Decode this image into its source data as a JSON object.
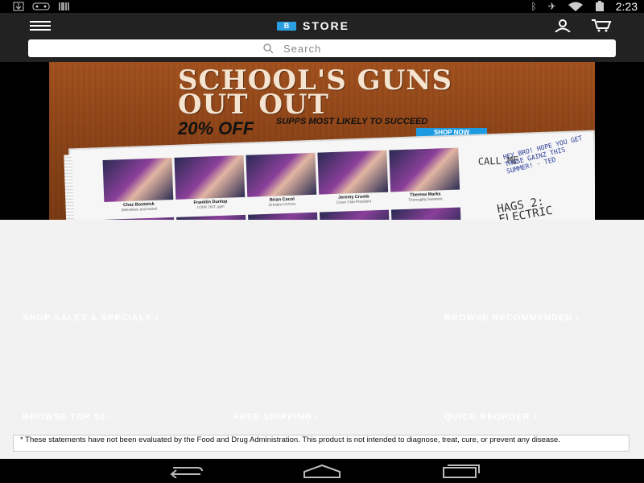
{
  "status_bar": {
    "left_icons": [
      "download-icon",
      "gamepad-icon",
      "barcode-icon"
    ],
    "right_icons": [
      "bluetooth-icon",
      "airplane-mode-icon",
      "wifi-icon",
      "battery-icon"
    ],
    "time": "2:23"
  },
  "header": {
    "brand_logo_text": "B",
    "title": "STORE",
    "icons": [
      "menu-icon",
      "account-icon",
      "cart-icon"
    ]
  },
  "search": {
    "placeholder": "Search"
  },
  "hero": {
    "title": "SCHOOL'S GUNS\nOUT OUT",
    "offer": "20% OFF",
    "subline": "SUPPS MOST LIKELY TO SUCCEED",
    "button": "SHOP NOW",
    "portraits": [
      {
        "name": "Chaz Bostwick",
        "caption": "Sleeveless and Award"
      },
      {
        "name": "Franklin Dunlop",
        "caption": "LOOK OUT, gym"
      },
      {
        "name": "Brian Cocol",
        "caption": "Greatest of Arms"
      },
      {
        "name": "Jeremy Crumb",
        "caption": "Cover Club President"
      },
      {
        "name": "Theresa Marks",
        "caption": "Thoroughly Sweetest"
      }
    ],
    "notes": {
      "main": "HEY BRO! HOPE YOU GET THOSE GAINZ THIS SUMMER! - TED",
      "call": "CALL ME",
      "ha": "HA",
      "hags": "HAGS 2: ELECTRIC"
    }
  },
  "promos": {
    "shop_sales": "SHOP SALES & SPECIALS",
    "browse_recommended": "BROWSE RECOMMENDED",
    "browse_top": "BROWSE TOP 50",
    "free_shipping": "FREE SHIPPING",
    "quick_reorder": "QUICK REORDER",
    "arrow": "›"
  },
  "disclaimer": "* These statements have not been evaluated by the Food and Drug Administration. This product is not intended to diagnose, treat, cure, or prevent any disease.",
  "nav_bar": {
    "icons": [
      "back-icon",
      "home-icon",
      "recents-icon"
    ]
  },
  "colors": {
    "header_bg": "#222222",
    "accent": "#2aa0e0",
    "page_bg": "#f2f2f2"
  }
}
